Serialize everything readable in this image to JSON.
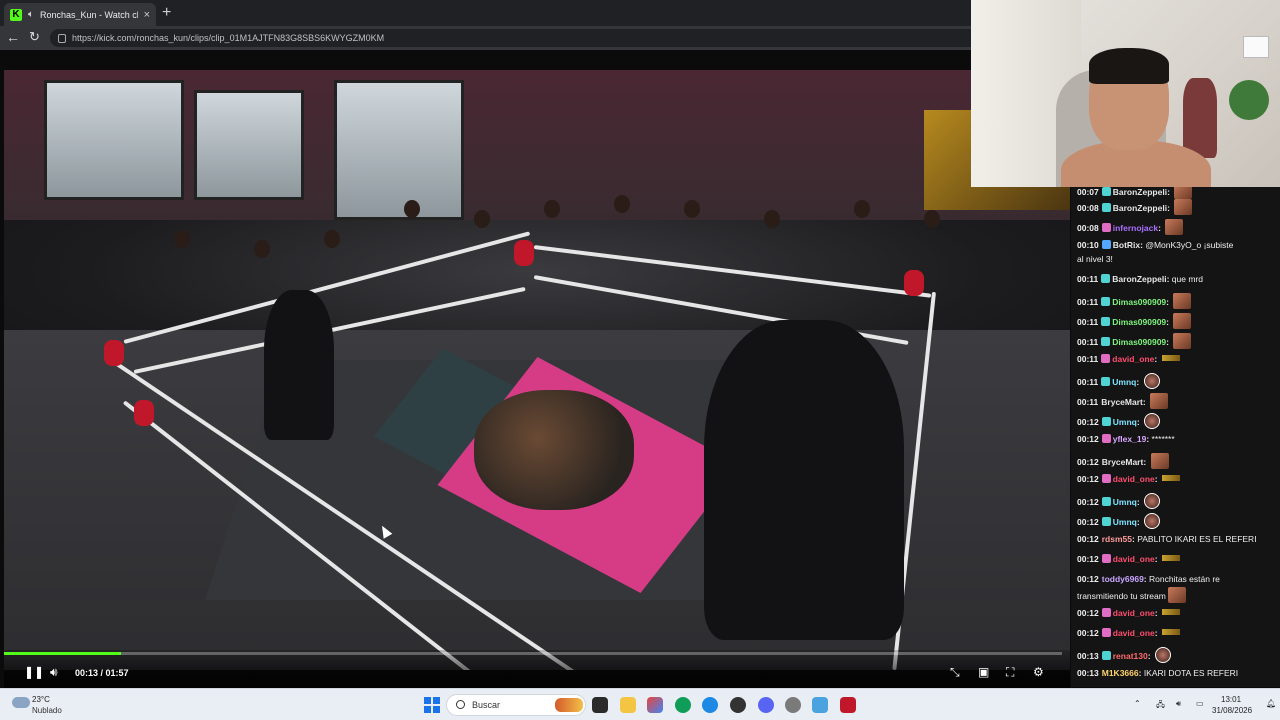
{
  "browser": {
    "tab_title": "Ronchas_Kun - Watch clips on",
    "tab_close": "×",
    "new_tab": "+",
    "favicon_letter": "K",
    "url": "https://kick.com/ronchas_kun/clips/clip_01M1AJTFN83G8SBS6KWYGZM0KM"
  },
  "player": {
    "time": "00:13 / 01:57",
    "progress_percent": 11.1,
    "accent_color": "#53fc18"
  },
  "chat": {
    "messages": [
      {
        "ts": "00:07",
        "user": "BaronZeppeli",
        "user_color": "#e6e6e6",
        "badge_color": "#4fd3d3",
        "text": "",
        "emote": "square"
      },
      {
        "ts": "00:08",
        "user": "BaronZeppeli",
        "user_color": "#e6e6e6",
        "badge_color": "#4fd3d3",
        "text": "",
        "emote": "square"
      },
      {
        "ts": "00:08",
        "user": "infernojack",
        "user_color": "#a970ff",
        "badge_color": "#e06cc3",
        "text": "",
        "emote": "square"
      },
      {
        "ts": "00:10",
        "user": "BotRix",
        "user_color": "#e6e6e6",
        "badge_color": "#53a7ff",
        "text": "@MonK3yO_o ¡subiste",
        "emote": ""
      },
      {
        "ts": "",
        "user": "",
        "user_color": "#e6e6e6",
        "badge_color": "",
        "text": "al nivel 3!",
        "emote": ""
      },
      {
        "ts": "00:11",
        "user": "BaronZeppeli",
        "user_color": "#e6e6e6",
        "badge_color": "#4fd3d3",
        "text": "que mrd",
        "emote": ""
      },
      {
        "ts": "00:11",
        "user": "Dimas090909",
        "user_color": "#7ef27e",
        "badge_color": "#4fd3d3",
        "text": "",
        "emote": "square"
      },
      {
        "ts": "00:11",
        "user": "Dimas090909",
        "user_color": "#7ef27e",
        "badge_color": "#4fd3d3",
        "text": "",
        "emote": "square"
      },
      {
        "ts": "00:11",
        "user": "Dimas090909",
        "user_color": "#7ef27e",
        "badge_color": "#4fd3d3",
        "text": "",
        "emote": "square"
      },
      {
        "ts": "00:11",
        "user": "david_one",
        "user_color": "#ff4d6d",
        "badge_color": "#e06cc3",
        "text": "",
        "emote": "bar"
      },
      {
        "ts": "00:11",
        "user": "Umnq",
        "user_color": "#7ee3ff",
        "badge_color": "#4fd3d3",
        "text": "",
        "emote": "round"
      },
      {
        "ts": "00:11",
        "user": "BryceMart",
        "user_color": "#e6e6e6",
        "badge_color": "",
        "text": "",
        "emote": "square"
      },
      {
        "ts": "00:12",
        "user": "Umnq",
        "user_color": "#7ee3ff",
        "badge_color": "#4fd3d3",
        "text": "",
        "emote": "round"
      },
      {
        "ts": "00:12",
        "user": "yflex_19",
        "user_color": "#d8a6ff",
        "badge_color": "#e06cc3",
        "text": "*******",
        "emote": ""
      },
      {
        "ts": "00:12",
        "user": "BryceMart",
        "user_color": "#e6e6e6",
        "badge_color": "",
        "text": "",
        "emote": "square"
      },
      {
        "ts": "00:12",
        "user": "david_one",
        "user_color": "#ff4d6d",
        "badge_color": "#e06cc3",
        "text": "",
        "emote": "bar"
      },
      {
        "ts": "00:12",
        "user": "Umnq",
        "user_color": "#7ee3ff",
        "badge_color": "#4fd3d3",
        "text": "",
        "emote": "round"
      },
      {
        "ts": "00:12",
        "user": "Umnq",
        "user_color": "#7ee3ff",
        "badge_color": "#4fd3d3",
        "text": "",
        "emote": "round"
      },
      {
        "ts": "00:12",
        "user": "rdsm55",
        "user_color": "#ff9b9b",
        "badge_color": "",
        "text": "PABLITO IKARI ES EL REFERI",
        "emote": ""
      },
      {
        "ts": "00:12",
        "user": "david_one",
        "user_color": "#ff4d6d",
        "badge_color": "#e06cc3",
        "text": "",
        "emote": "bar"
      },
      {
        "ts": "00:12",
        "user": "toddy6969",
        "user_color": "#c9a6ff",
        "badge_color": "",
        "text": "Ronchitas están re",
        "emote": ""
      },
      {
        "ts": "",
        "user": "",
        "user_color": "#e6e6e6",
        "badge_color": "",
        "text": "transmitiendo tu stream",
        "emote": "square"
      },
      {
        "ts": "00:12",
        "user": "david_one",
        "user_color": "#ff4d6d",
        "badge_color": "#e06cc3",
        "text": "",
        "emote": "bar"
      },
      {
        "ts": "00:12",
        "user": "david_one",
        "user_color": "#ff4d6d",
        "badge_color": "#e06cc3",
        "text": "",
        "emote": "bar"
      },
      {
        "ts": "00:13",
        "user": "renat130",
        "user_color": "#ff6b6b",
        "badge_color": "#4fd3d3",
        "text": "",
        "emote": "round"
      },
      {
        "ts": "00:13",
        "user": "M1K3666",
        "user_color": "#ffd36b",
        "badge_color": "",
        "text": "IKARI DOTA ES REFERI",
        "emote": ""
      }
    ]
  },
  "taskbar": {
    "temperature": "23°C",
    "weather": "Nublado",
    "search_placeholder": "Buscar",
    "time": "13:01",
    "date": "31/08/2026"
  }
}
